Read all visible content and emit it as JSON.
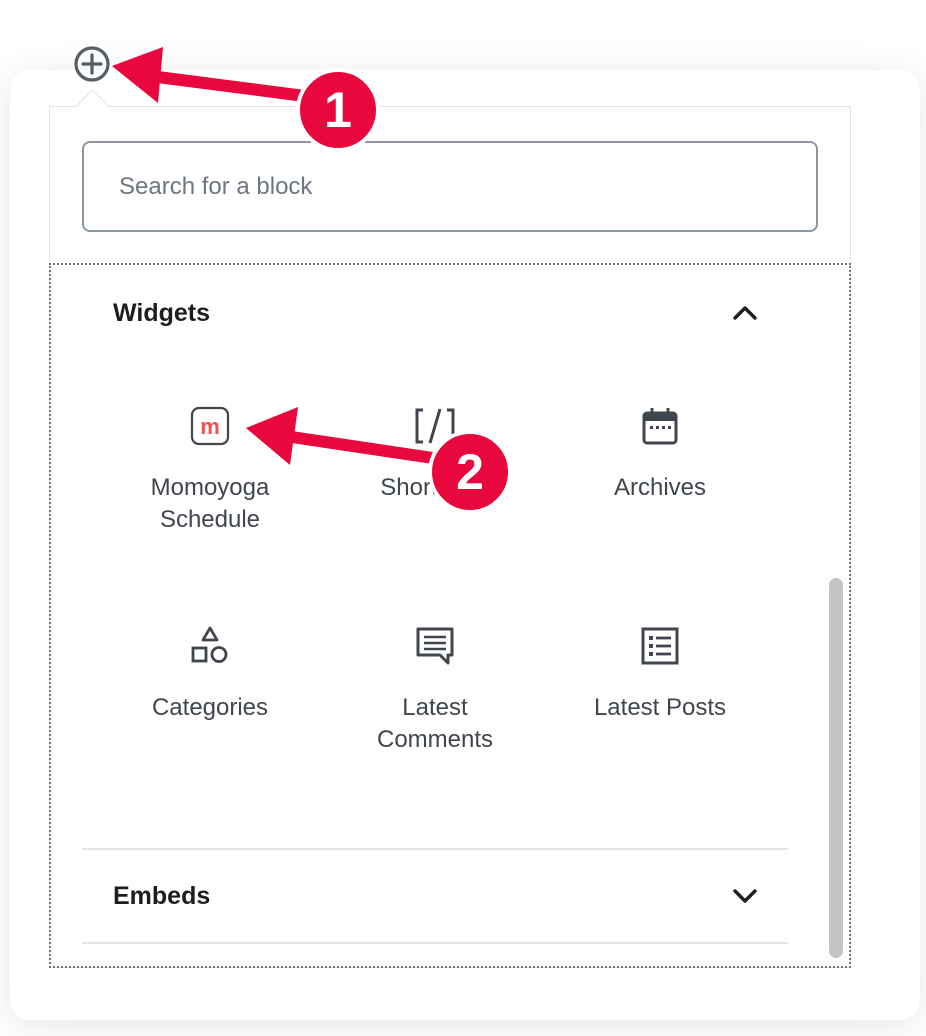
{
  "inserter": {
    "toggle_icon": "plus-circle-icon",
    "search": {
      "placeholder": "Search for a block",
      "value": ""
    }
  },
  "panels": [
    {
      "title": "Widgets",
      "expanded": true,
      "toggle_icon": "chevron-up-icon",
      "blocks": [
        {
          "label": "Momoyoga\nSchedule",
          "icon": "momoyoga-logo-icon",
          "accent": "#f0504f"
        },
        {
          "label": "Shortcode",
          "icon": "shortcode-icon"
        },
        {
          "label": "Archives",
          "icon": "calendar-icon"
        },
        {
          "label": "Categories",
          "icon": "categories-icon"
        },
        {
          "label": "Latest\nComments",
          "icon": "comments-icon"
        },
        {
          "label": "Latest Posts",
          "icon": "list-icon"
        }
      ]
    },
    {
      "title": "Embeds",
      "expanded": false,
      "toggle_icon": "chevron-down-icon"
    }
  ],
  "annotations": [
    {
      "number": "1",
      "color": "#e8083e"
    },
    {
      "number": "2",
      "color": "#e8083e"
    }
  ],
  "colors": {
    "icon": "#40464d",
    "annotation": "#e8083e",
    "brand_m": "#f0504f"
  }
}
